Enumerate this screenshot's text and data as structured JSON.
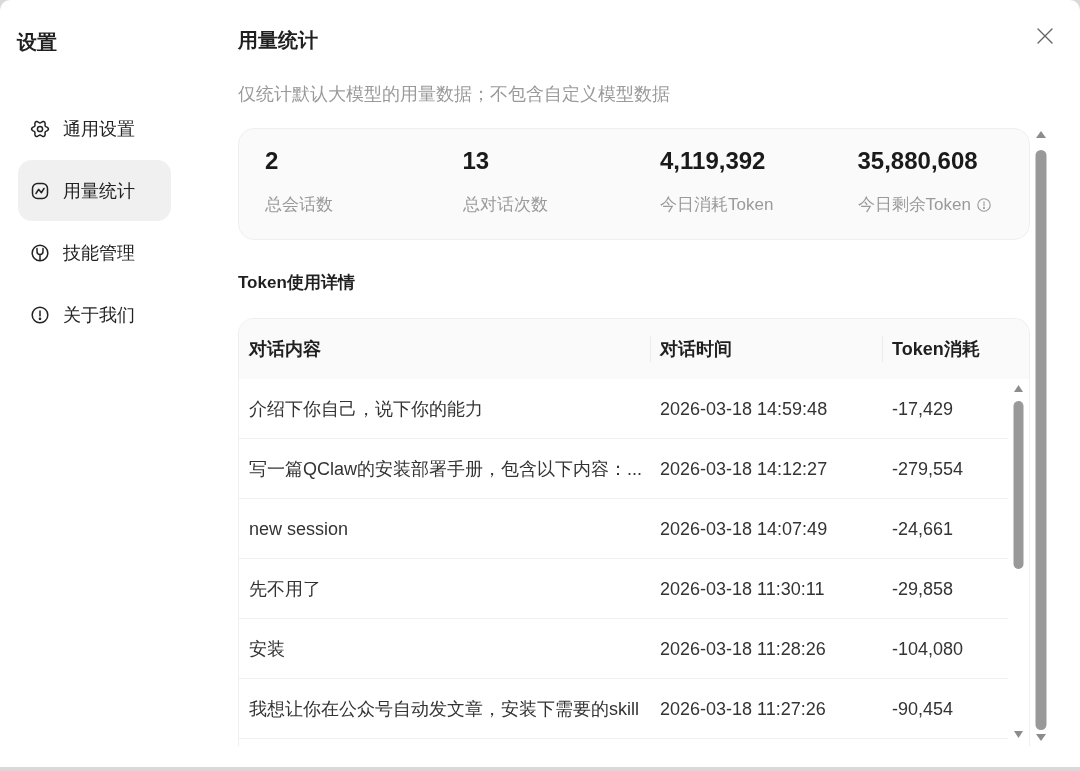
{
  "sidebar": {
    "title": "设置",
    "items": [
      {
        "label": "通用设置",
        "selected": false
      },
      {
        "label": "用量统计",
        "selected": true
      },
      {
        "label": "技能管理",
        "selected": false
      },
      {
        "label": "关于我们",
        "selected": false
      }
    ]
  },
  "main": {
    "title": "用量统计",
    "note": "仅统计默认大模型的用量数据；不包含自定义模型数据"
  },
  "stats": [
    {
      "value": "2",
      "label": "总会话数",
      "info": false
    },
    {
      "value": "13",
      "label": "总对话次数",
      "info": false
    },
    {
      "value": "4,119,392",
      "label": "今日消耗Token",
      "info": false
    },
    {
      "value": "35,880,608",
      "label": "今日剩余Token",
      "info": true
    }
  ],
  "details": {
    "title": "Token使用详情",
    "columns": [
      "对话内容",
      "对话时间",
      "Token消耗"
    ],
    "rows": [
      [
        "介绍下你自己，说下你的能力",
        "2026-03-18 14:59:48",
        "-17,429"
      ],
      [
        "写一篇QClaw的安装部署手册，包含以下内容：...",
        "2026-03-18 14:12:27",
        "-279,554"
      ],
      [
        "new session",
        "2026-03-18 14:07:49",
        "-24,661"
      ],
      [
        "先不用了",
        "2026-03-18 11:30:11",
        "-29,858"
      ],
      [
        "安装",
        "2026-03-18 11:28:26",
        "-104,080"
      ],
      [
        "我想让你在公众号自动发文章，安装下需要的skill",
        "2026-03-18 11:27:26",
        "-90,454"
      ]
    ]
  }
}
